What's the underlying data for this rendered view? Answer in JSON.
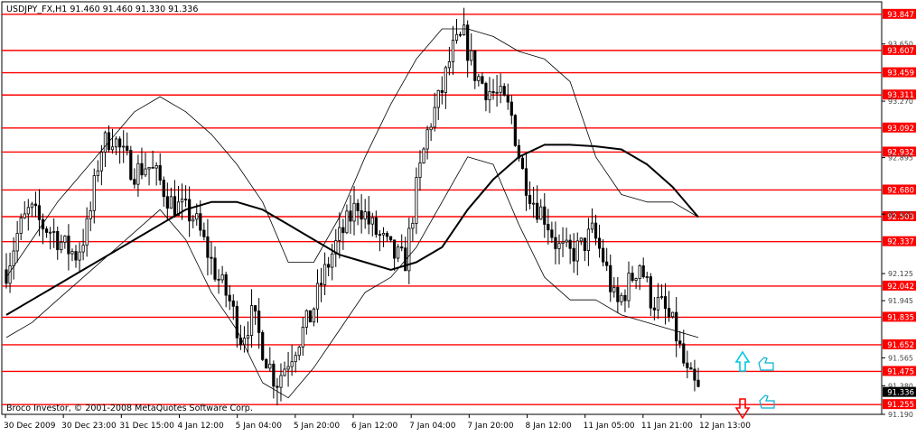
{
  "window": {
    "symbol_header": "USDJPY_FX,H1  91.460 91.460 91.330 91.336",
    "copyright": "Broco Investor, © 2001-2008 MetaQuotes Software Corp."
  },
  "colors": {
    "background": "#ffffff",
    "candles": "#000000",
    "level_line": "#ff0000",
    "level_box": "#ff0000",
    "current_box": "#000000",
    "arrow_up": "#00c8e0",
    "arrow_down": "#ff0000",
    "hand_icon": "#00b0d0"
  },
  "icons": {
    "arrow_up": "up-arrow-icon",
    "arrow_down": "down-arrow-icon",
    "hand_up": "thumbs-up-icon",
    "hand_down": "thumbs-down-icon"
  },
  "chart_data": {
    "type": "candlestick",
    "title": "USDJPY_FX,H1",
    "ylim": [
      91.19,
      93.93
    ],
    "grid": false,
    "x_tick_labels": [
      "30 Dec 2009",
      "30 Dec 23:00",
      "31 Dec 15:00",
      "4 Jan 12:00",
      "5 Jan 04:00",
      "5 Jan 20:00",
      "6 Jan 12:00",
      "7 Jan 04:00",
      "7 Jan 20:00",
      "8 Jan 12:00",
      "11 Jan 05:00",
      "11 Jan 21:00",
      "12 Jan 13:00"
    ],
    "y_tick_labels": [
      "93.650",
      "93.270",
      "92.895",
      "92.520",
      "92.125",
      "91.945",
      "91.565",
      "91.380",
      "91.190"
    ],
    "levels": [
      "93.847",
      "93.607",
      "93.459",
      "93.311",
      "93.092",
      "92.932",
      "92.680",
      "92.503",
      "92.337",
      "92.042",
      "91.835",
      "91.652",
      "91.475",
      "91.255"
    ],
    "current_price": "91.336",
    "close_path": [
      92.15,
      92.4,
      92.55,
      92.45,
      92.4,
      92.3,
      92.25,
      92.45,
      92.95,
      93.05,
      92.9,
      92.8,
      92.85,
      92.75,
      92.6,
      92.55,
      92.5,
      92.3,
      92.1,
      91.95,
      91.7,
      91.85,
      91.6,
      91.4,
      91.55,
      91.7,
      91.85,
      92.1,
      92.3,
      92.45,
      92.6,
      92.45,
      92.35,
      92.25,
      92.2,
      92.7,
      93.1,
      93.3,
      93.6,
      93.7,
      93.45,
      93.35,
      93.3,
      93.2,
      92.8,
      92.6,
      92.5,
      92.3,
      92.25,
      92.3,
      92.4,
      92.2,
      91.9,
      92.05,
      92.2,
      91.95,
      91.9,
      91.75,
      91.45,
      91.34
    ],
    "moving_averages": [
      {
        "values": [
          91.85,
          91.95,
          92.05,
          92.15,
          92.25,
          92.35,
          92.45,
          92.55,
          92.6,
          92.6,
          92.55,
          92.45,
          92.35,
          92.25,
          92.2,
          92.15,
          92.2,
          92.3,
          92.55,
          92.75,
          92.9,
          92.98,
          92.98,
          92.97,
          92.95,
          92.85,
          92.7,
          92.5
        ]
      },
      {
        "values": [
          92.1,
          92.35,
          92.6,
          92.8,
          93.0,
          93.2,
          93.3,
          93.2,
          93.05,
          92.85,
          92.6,
          92.2,
          92.2,
          92.5,
          92.9,
          93.25,
          93.55,
          93.75,
          93.75,
          93.7,
          93.6,
          93.55,
          93.4,
          92.9,
          92.65,
          92.6,
          92.6,
          92.5
        ]
      },
      {
        "values": [
          91.7,
          91.8,
          91.95,
          92.1,
          92.25,
          92.4,
          92.55,
          92.35,
          92.0,
          91.75,
          91.4,
          91.3,
          91.5,
          91.75,
          92.0,
          92.1,
          92.3,
          92.6,
          92.9,
          92.85,
          92.45,
          92.1,
          91.95,
          91.95,
          91.85,
          91.8,
          91.75,
          91.7
        ]
      }
    ]
  }
}
